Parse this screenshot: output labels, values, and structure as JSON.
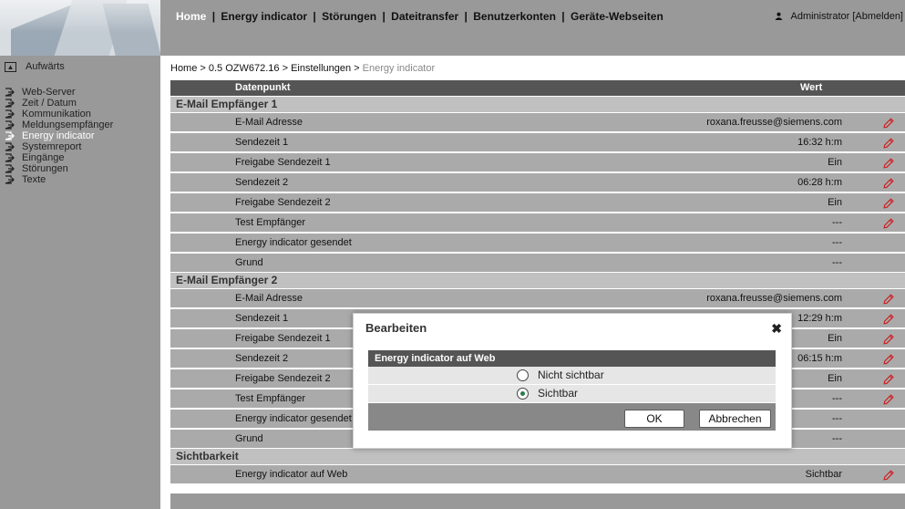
{
  "topnav": {
    "items": [
      "Home",
      "Energy indicator",
      "Störungen",
      "Dateitransfer",
      "Benutzerkonten",
      "Geräte-Webseiten"
    ],
    "separator": "|"
  },
  "user": {
    "name": "Administrator",
    "logout": "[Abmelden]"
  },
  "sidebar": {
    "up_label": "Aufwärts",
    "items": [
      "Web-Server",
      "Zeit / Datum",
      "Kommunikation",
      "Meldungsempfänger",
      "Energy indicator",
      "Systemreport",
      "Eingänge",
      "Störungen",
      "Texte"
    ],
    "active_index": 4
  },
  "breadcrumb": {
    "path": "Home > 0.5 OZW672.16 > Einstellungen > ",
    "current": "Energy indicator"
  },
  "table": {
    "col_datapoint": "Datenpunkt",
    "col_value": "Wert",
    "sections": [
      {
        "title": "E-Mail Empfänger 1",
        "rows": [
          {
            "label": "E-Mail Adresse",
            "value": "roxana.freusse@siemens.com",
            "editable": true
          },
          {
            "label": "Sendezeit 1",
            "value": "16:32 h:m",
            "editable": true
          },
          {
            "label": "Freigabe Sendezeit 1",
            "value": "Ein",
            "editable": true
          },
          {
            "label": "Sendezeit 2",
            "value": "06:28 h:m",
            "editable": true
          },
          {
            "label": "Freigabe Sendezeit 2",
            "value": "Ein",
            "editable": true
          },
          {
            "label": "Test Empfänger",
            "value": "---",
            "editable": true
          },
          {
            "label": "Energy indicator gesendet",
            "value": "---",
            "editable": false
          },
          {
            "label": "Grund",
            "value": "---",
            "editable": false
          }
        ]
      },
      {
        "title": "E-Mail Empfänger 2",
        "rows": [
          {
            "label": "E-Mail Adresse",
            "value": "roxana.freusse@siemens.com",
            "editable": true
          },
          {
            "label": "Sendezeit 1",
            "value": "12:29 h:m",
            "editable": true
          },
          {
            "label": "Freigabe Sendezeit 1",
            "value": "Ein",
            "editable": true
          },
          {
            "label": "Sendezeit 2",
            "value": "06:15 h:m",
            "editable": true
          },
          {
            "label": "Freigabe Sendezeit 2",
            "value": "Ein",
            "editable": true
          },
          {
            "label": "Test Empfänger",
            "value": "---",
            "editable": true
          },
          {
            "label": "Energy indicator gesendet",
            "value": "---",
            "editable": false
          },
          {
            "label": "Grund",
            "value": "---",
            "editable": false
          }
        ]
      },
      {
        "title": "Sichtbarkeit",
        "rows": [
          {
            "label": "Energy indicator auf Web",
            "value": "Sichtbar",
            "editable": true
          }
        ]
      }
    ]
  },
  "dialog": {
    "title": "Bearbeiten",
    "close": "✖",
    "panel_title": "Energy indicator auf Web",
    "options": [
      "Nicht sichtbar",
      "Sichtbar"
    ],
    "selected_index": 1,
    "ok": "OK",
    "cancel": "Abbrechen"
  },
  "icons": {
    "edit": "pencil-icon",
    "user": "user-icon",
    "up": "up-arrow-box-icon",
    "nav": "exit-arrow-icon",
    "close": "close-icon"
  },
  "colors": {
    "header_gray": "#999999",
    "row_gray": "#aaaaaa",
    "dark_header": "#555555",
    "edit_red": "#cc1f1f",
    "radio_green": "#2a7a4a"
  }
}
